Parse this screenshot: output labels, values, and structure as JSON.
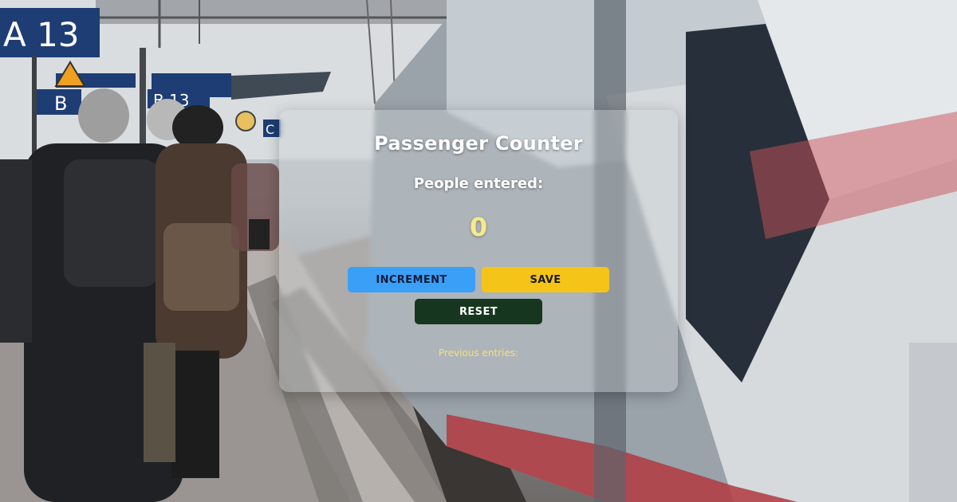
{
  "colors": {
    "increment_bg": "#3aa0f7",
    "increment_text": "#0d1b3d",
    "save_bg": "#f4c518",
    "save_text": "#1a1a1a",
    "reset_bg": "#17361f",
    "reset_text": "#ffffff",
    "count_color": "#f6ea8a",
    "entries_color": "#f4e27a"
  },
  "counter": {
    "title": "Passenger Counter",
    "count_label": "People entered:",
    "count_value": "0"
  },
  "buttons": {
    "increment_label": "INCREMENT",
    "save_label": "SAVE",
    "reset_label": "RESET"
  },
  "entries": {
    "label": "Previous entries:",
    "list": ""
  },
  "background_signs": {
    "platform_sign": "A 13",
    "sign_b": "B",
    "sign_b13": "B 13",
    "sign_c": "C"
  }
}
